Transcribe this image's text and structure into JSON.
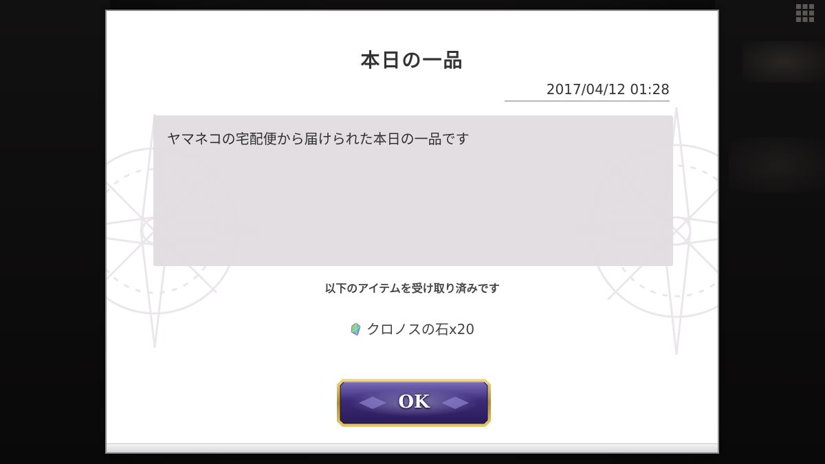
{
  "dialog": {
    "title": "本日の一品",
    "date": "2017/04/12 01:28",
    "message": "ヤマネコの宅配便から届けられた本日の一品です",
    "received_label": "以下のアイテムを受け取り済みです",
    "item": {
      "icon": "rainbow-crystal-icon",
      "label": "クロノスの石x20"
    },
    "ok_button_label": "OK"
  },
  "colors": {
    "dialog_background": "#ffffff",
    "message_box": "#e1dbe0",
    "text": "#333333",
    "button_frame": "#c8a64a",
    "button_fill": "#3d2f7a"
  }
}
